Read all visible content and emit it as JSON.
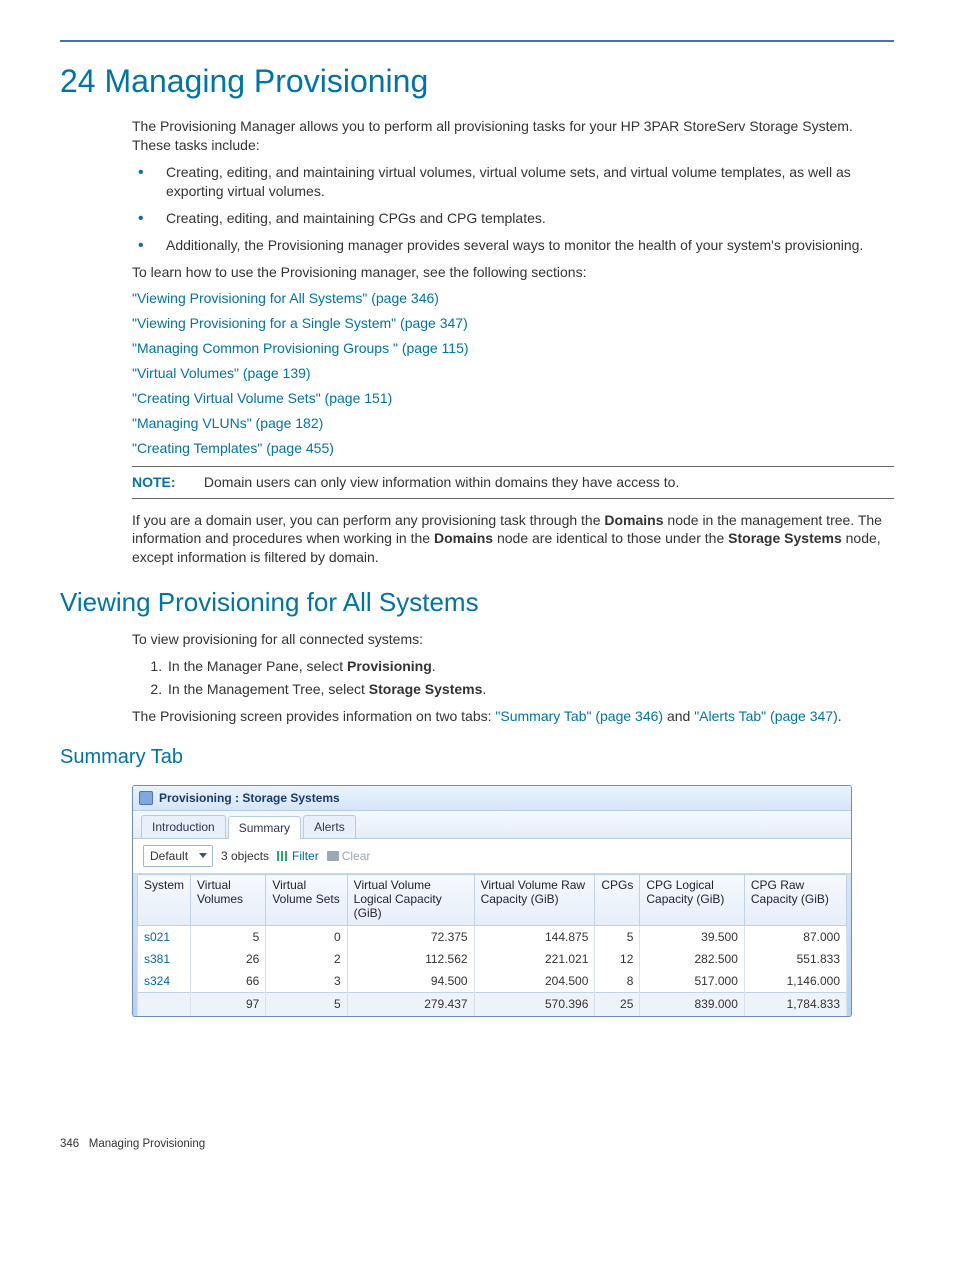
{
  "chapter_title": "24 Managing Provisioning",
  "intro": "The Provisioning Manager allows you to perform all provisioning tasks for your HP 3PAR StoreServ Storage System. These tasks include:",
  "bullets": [
    "Creating, editing, and maintaining virtual volumes, virtual volume sets, and virtual volume templates, as well as exporting virtual volumes.",
    "Creating, editing, and maintaining CPGs and CPG templates.",
    "Additionally, the Provisioning manager provides several ways to monitor the health of your system's provisioning."
  ],
  "learn": "To learn how to use the Provisioning manager, see the following sections:",
  "links": [
    "\"Viewing Provisioning for All Systems\" (page 346)",
    "\"Viewing Provisioning for a Single System\" (page 347)",
    "\"Managing Common Provisioning Groups \" (page 115)",
    "\"Virtual Volumes\" (page 139)",
    "\"Creating Virtual Volume Sets\" (page 151)",
    "\"Managing VLUNs\" (page 182)",
    "\"Creating Templates\" (page 455)"
  ],
  "note_label": "NOTE:",
  "note_text": "Domain users can only view information within domains they have access to.",
  "domain_para_pre": "If you are a domain user, you can perform any provisioning task through the ",
  "domain_bold1": "Domains",
  "domain_para_mid1": " node in the management tree. The information and procedures when working in the ",
  "domain_bold2": "Domains",
  "domain_para_mid2": " node are identical to those under the ",
  "domain_bold3": "Storage Systems",
  "domain_para_end": " node, except information is filtered by domain.",
  "section2": "Viewing Provisioning for All Systems",
  "section2_intro": "To view provisioning for all connected systems:",
  "step1_pre": "In the Manager Pane, select ",
  "step1_bold": "Provisioning",
  "step1_post": ".",
  "step2_pre": "In the Management Tree, select ",
  "step2_bold": "Storage Systems",
  "step2_post": ".",
  "tabs_sentence_pre": "The Provisioning screen provides information on two tabs: ",
  "tabs_link1": "\"Summary Tab\" (page 346)",
  "tabs_sentence_mid": " and ",
  "tabs_link2": "\"Alerts Tab\" (page 347)",
  "tabs_sentence_post": ".",
  "subsection": "Summary Tab",
  "window": {
    "title": "Provisioning : Storage Systems",
    "tabs": [
      "Introduction",
      "Summary",
      "Alerts"
    ],
    "active_tab": 1,
    "dropdown": "Default",
    "count": "3 objects",
    "filter": "Filter",
    "clear": "Clear"
  },
  "chart_data": {
    "type": "table",
    "columns": [
      "System",
      "Virtual Volumes",
      "Virtual Volume Sets",
      "Virtual Volume Logical Capacity (GiB)",
      "Virtual Volume Raw Capacity (GiB)",
      "CPGs",
      "CPG Logical Capacity (GiB)",
      "CPG Raw Capacity (GiB)"
    ],
    "rows": [
      {
        "system": "s021",
        "vv": 5,
        "vvs": 0,
        "vvlc": "72.375",
        "vvrc": "144.875",
        "cpgs": 5,
        "cpgl": "39.500",
        "cpgr": "87.000"
      },
      {
        "system": "s381",
        "vv": 26,
        "vvs": 2,
        "vvlc": "112.562",
        "vvrc": "221.021",
        "cpgs": 12,
        "cpgl": "282.500",
        "cpgr": "551.833"
      },
      {
        "system": "s324",
        "vv": 66,
        "vvs": 3,
        "vvlc": "94.500",
        "vvrc": "204.500",
        "cpgs": 8,
        "cpgl": "517.000",
        "cpgr": "1,146.000"
      }
    ],
    "totals": {
      "system": "",
      "vv": 97,
      "vvs": 5,
      "vvlc": "279.437",
      "vvrc": "570.396",
      "cpgs": 25,
      "cpgl": "839.000",
      "cpgr": "1,784.833"
    }
  },
  "footer_page": "346",
  "footer_title": "Managing Provisioning"
}
